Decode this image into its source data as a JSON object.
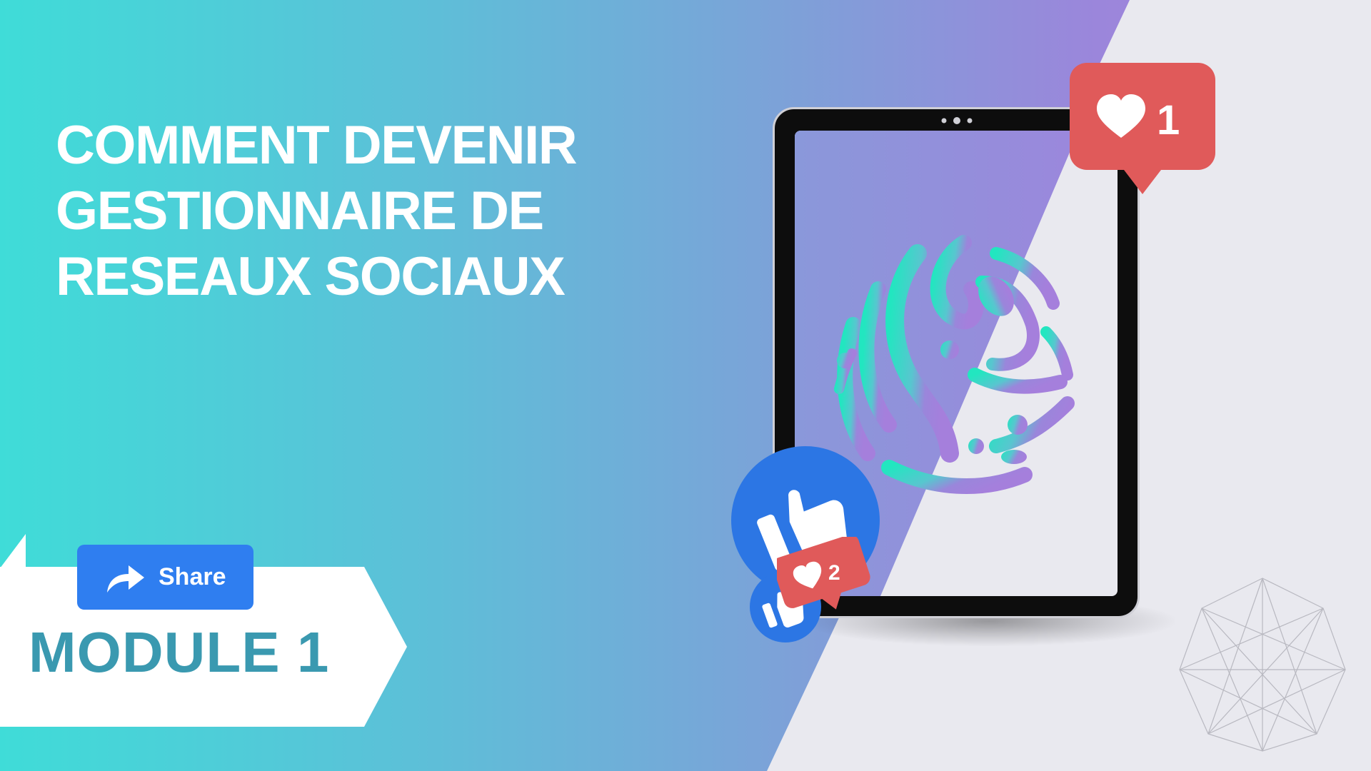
{
  "title": {
    "line1": "COMMENT DEVENIR",
    "line2": "GESTIONNAIRE DE",
    "line3": "RESEAUX SOCIAUX"
  },
  "share": {
    "label": "Share",
    "icon": "share-arrow-icon"
  },
  "module": {
    "label": "MODULE 1"
  },
  "badges": {
    "heart_count": "1",
    "mini_heart_count": "2"
  },
  "icons": {
    "heart": "heart-icon",
    "like": "thumbs-up-icon",
    "logo": "globe-logo"
  },
  "colors": {
    "teal": "#3fdcd8",
    "purple": "#a57fdc",
    "share_blue": "#2f7ef0",
    "facebook_blue": "#2c76e4",
    "notification_red": "#e05a5a",
    "module_text": "#3a99b0",
    "background": "#e9e9ef"
  }
}
